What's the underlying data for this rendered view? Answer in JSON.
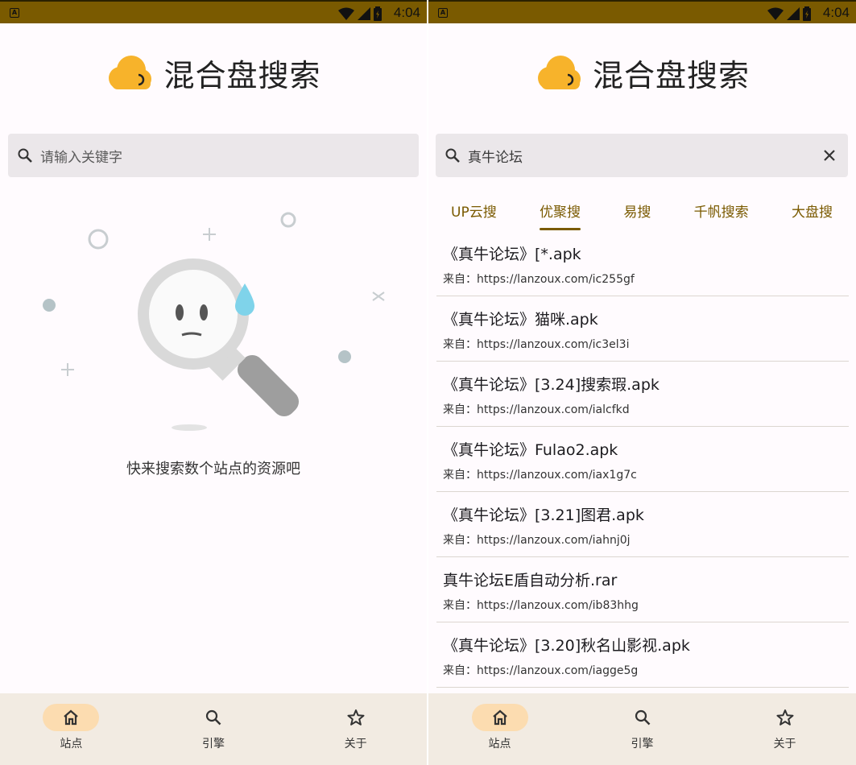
{
  "status_bar": {
    "time": "4:04",
    "notification_icon": "a-icon",
    "icons": [
      "wifi-icon",
      "signal-icon",
      "battery-icon"
    ]
  },
  "colors": {
    "accent": "#7a5a00",
    "logo": "#f7b32b",
    "nav_bg": "#f2ebe2",
    "nav_active": "#fcdcb0",
    "search_bg": "#ebe7ea"
  },
  "left": {
    "app_title": "混合盘搜索",
    "search": {
      "placeholder": "请输入关键字",
      "value": ""
    },
    "empty_message": "快来搜索数个站点的资源吧"
  },
  "right": {
    "app_title": "混合盘搜索",
    "search": {
      "placeholder": "请输入关键字",
      "value": "真牛论坛"
    },
    "tabs": [
      {
        "label": "UP云搜",
        "active": false
      },
      {
        "label": "优聚搜",
        "active": true
      },
      {
        "label": "易搜",
        "active": false
      },
      {
        "label": "千帆搜索",
        "active": false
      },
      {
        "label": "大盘搜",
        "active": false
      }
    ],
    "results": [
      {
        "title": "《真牛论坛》[*.apk",
        "source": "来自：https://lanzoux.com/ic255gf"
      },
      {
        "title": "《真牛论坛》猫咪.apk",
        "source": "来自：https://lanzoux.com/ic3el3i"
      },
      {
        "title": "《真牛论坛》[3.24]搜索瑕.apk",
        "source": "来自：https://lanzoux.com/ialcfkd"
      },
      {
        "title": "《真牛论坛》Fulao2.apk",
        "source": "来自：https://lanzoux.com/iax1g7c"
      },
      {
        "title": "《真牛论坛》[3.21]图君.apk",
        "source": "来自：https://lanzoux.com/iahnj0j"
      },
      {
        "title": "真牛论坛E盾自动分析.rar",
        "source": "来自：https://lanzoux.com/ib83hhg"
      },
      {
        "title": "《真牛论坛》[3.20]秋名山影视.apk",
        "source": "来自：https://lanzoux.com/iagge5g"
      }
    ]
  },
  "bottom_nav": [
    {
      "label": "站点",
      "icon": "home-icon",
      "active": true
    },
    {
      "label": "引擎",
      "icon": "search-icon",
      "active": false
    },
    {
      "label": "关于",
      "icon": "star-icon",
      "active": false
    }
  ]
}
